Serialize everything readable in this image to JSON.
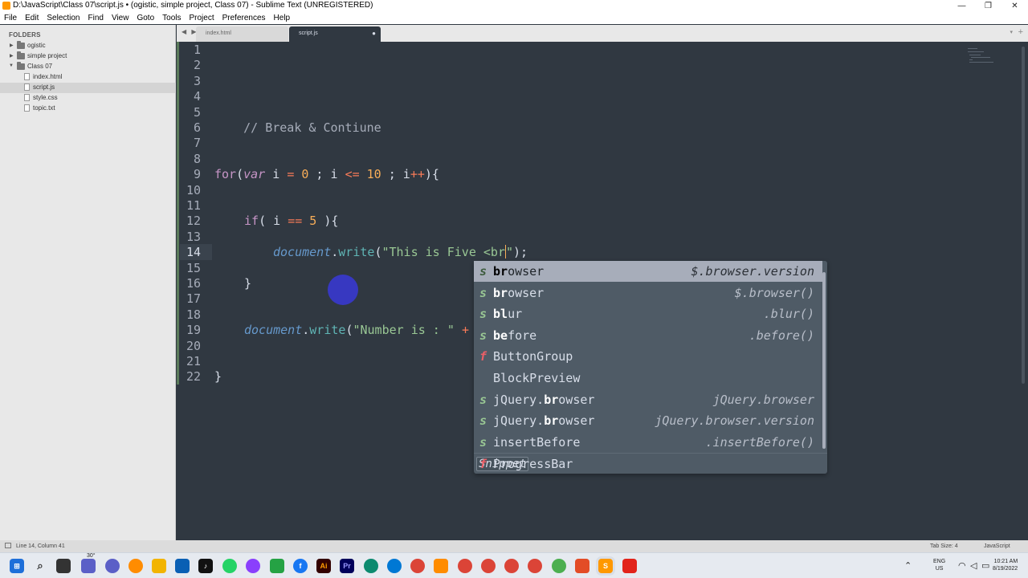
{
  "window": {
    "title": "D:\\JavaScript\\Class 07\\script.js • (ogistic, simple project, Class 07) - Sublime Text (UNREGISTERED)",
    "controls": [
      "—",
      "❐",
      "✕"
    ]
  },
  "menu": [
    "File",
    "Edit",
    "Selection",
    "Find",
    "View",
    "Goto",
    "Tools",
    "Project",
    "Preferences",
    "Help"
  ],
  "sidebar": {
    "heading": "FOLDERS",
    "items": [
      {
        "label": "ogistic",
        "type": "folder",
        "expanded": false
      },
      {
        "label": "simple project",
        "type": "folder",
        "expanded": false
      },
      {
        "label": "Class 07",
        "type": "folder",
        "expanded": true
      },
      {
        "label": "index.html",
        "type": "file"
      },
      {
        "label": "script.js",
        "type": "file",
        "selected": true
      },
      {
        "label": "style.css",
        "type": "file"
      },
      {
        "label": "topic.txt",
        "type": "file"
      }
    ]
  },
  "tabs": [
    {
      "label": "index.html",
      "active": false
    },
    {
      "label": "script.js",
      "active": true,
      "dirty_marker": "●"
    }
  ],
  "tabbar": {
    "nav": "◀ ▶",
    "plus": "+",
    "dropdown": "▾"
  },
  "editor": {
    "line_numbers": [
      "1",
      "2",
      "3",
      "4",
      "5",
      "6",
      "7",
      "8",
      "9",
      "10",
      "11",
      "12",
      "13",
      "14",
      "15",
      "16",
      "17",
      "18",
      "19",
      "20",
      "21",
      "22"
    ],
    "current_line": "14",
    "code": {
      "l5": "// Break & Contiune",
      "l9": {
        "t1": "for",
        "t2": "(",
        "t3": "var",
        "t4": " i ",
        "t5": "=",
        "t6": " ",
        "t7": "0",
        "t8": " ; i ",
        "t9": "<=",
        "t10": " ",
        "t11": "10",
        "t12": " ; i",
        "t13": "++",
        "t14": "){"
      },
      "l12": {
        "t1": "if",
        "t2": "( i ",
        "t3": "==",
        "t4": " ",
        "t5": "5",
        "t6": " ){"
      },
      "l14": {
        "t1": "document",
        "t2": ".",
        "t3": "write",
        "t4": "(",
        "t5": "\"This is Five <br",
        "t6": "\"",
        "t7": ");"
      },
      "l16": "}",
      "l19": {
        "t1": "document",
        "t2": ".",
        "t3": "write",
        "t4": "(",
        "t5": "\"Number is : \"",
        "t6": " ",
        "t7": "+"
      },
      "l22": "}"
    }
  },
  "autocomplete": {
    "items": [
      {
        "kind": "s",
        "pre": "",
        "bold": "br",
        "post": "owser",
        "detail": "$.browser.version",
        "selected": true
      },
      {
        "kind": "s",
        "pre": "",
        "bold": "br",
        "post": "owser",
        "detail": "$.browser()"
      },
      {
        "kind": "s",
        "pre": "",
        "bold": "bl",
        "post": "ur",
        "detail": ".blur()"
      },
      {
        "kind": "s",
        "pre": "",
        "bold": "be",
        "post": "fore",
        "detail": ".before()"
      },
      {
        "kind": "f",
        "pre": "ButtonGroup",
        "bold": "",
        "post": "",
        "detail": ""
      },
      {
        "kind": "",
        "pre": "BlockPreview",
        "bold": "",
        "post": "",
        "detail": ""
      },
      {
        "kind": "s",
        "pre": "jQuery.",
        "bold": "br",
        "post": "owser",
        "detail": "jQuery.browser"
      },
      {
        "kind": "s",
        "pre": "jQuery.",
        "bold": "br",
        "post": "owser",
        "detail": "jQuery.browser.version"
      },
      {
        "kind": "s",
        "pre": "insertBefore",
        "bold": "",
        "post": "",
        "detail": ".insertBefore()"
      },
      {
        "kind": "f",
        "pre": "ProgressBar",
        "bold": "",
        "post": "",
        "detail": ""
      }
    ],
    "footer": "Snippet"
  },
  "statusbar": {
    "position": "Line 14, Column 41",
    "tab_size": "Tab Size: 4",
    "syntax": "JavaScript"
  },
  "taskbar": {
    "weather": "30°",
    "lang_top": "ENG",
    "lang_bottom": "US",
    "time": "10:21 AM",
    "date": "8/19/2022",
    "icon_colors": {
      "start": "#1e6fd9",
      "search": "#333333",
      "taskview": "#333333",
      "chat": "#5b5fc7",
      "explorer": "#f2b400",
      "store": "#0a5fb4",
      "tiktok": "#111111",
      "whatsapp": "#25d366",
      "messenger": "#8a3ffc",
      "illustrator": "#ff9a00",
      "premiere": "#9999ff",
      "edge": "#0c8a6f",
      "chrome": "#db4437",
      "sublime": "#ff9800",
      "acrobat": "#e2231a",
      "facebook": "#1877f2"
    }
  }
}
